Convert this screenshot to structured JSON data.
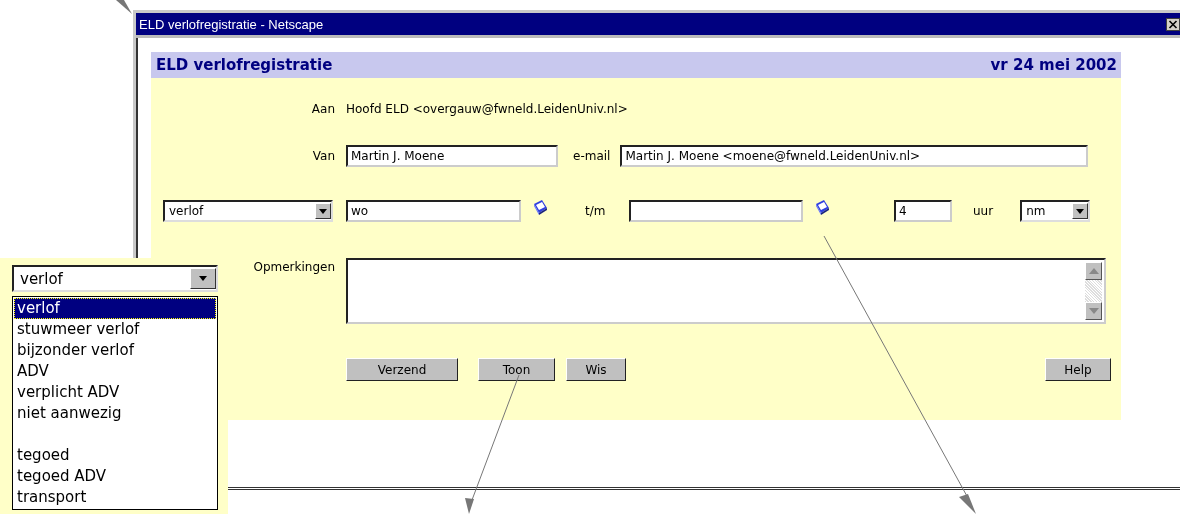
{
  "window": {
    "title": "ELD verlofregistratie - Netscape"
  },
  "header": {
    "title": "ELD verlofregistratie",
    "date": "vr 24 mei 2002"
  },
  "to": {
    "label": "Aan",
    "value": "Hoofd ELD <overgauw@fwneld.LeidenUniv.nl>"
  },
  "from": {
    "label": "Van",
    "value": "Martin J. Moene"
  },
  "email": {
    "label": "e-mail",
    "value": "Martin J. Moene <moene@fwneld.LeidenUniv.nl>"
  },
  "leave": {
    "type_value": "verlof",
    "from_value": "wo",
    "until_label": "t/m",
    "hours_value": "4",
    "hours_unit": "uur",
    "part_value": "nm"
  },
  "remarks": {
    "label": "Opmerkingen"
  },
  "buttons": [
    {
      "label": "Verzend"
    },
    {
      "label": "Toon"
    },
    {
      "label": "Wis"
    }
  ],
  "help_button": {
    "label": "Help"
  },
  "dropdown": {
    "value": "verlof",
    "options": [
      {
        "kind": "option",
        "label": "verlof",
        "selected": true
      },
      {
        "kind": "option",
        "label": "stuwmeer verlof",
        "selected": false
      },
      {
        "kind": "option",
        "label": "bijzonder verlof",
        "selected": false
      },
      {
        "kind": "option",
        "label": "ADV",
        "selected": false
      },
      {
        "kind": "option",
        "label": "verplicht ADV",
        "selected": false
      },
      {
        "kind": "option",
        "label": "niet aanwezig",
        "selected": false
      },
      {
        "kind": "separator"
      },
      {
        "kind": "option",
        "label": "tegoed",
        "selected": false
      },
      {
        "kind": "option",
        "label": "tegoed ADV",
        "selected": false
      },
      {
        "kind": "option",
        "label": "transport",
        "selected": false
      }
    ]
  }
}
